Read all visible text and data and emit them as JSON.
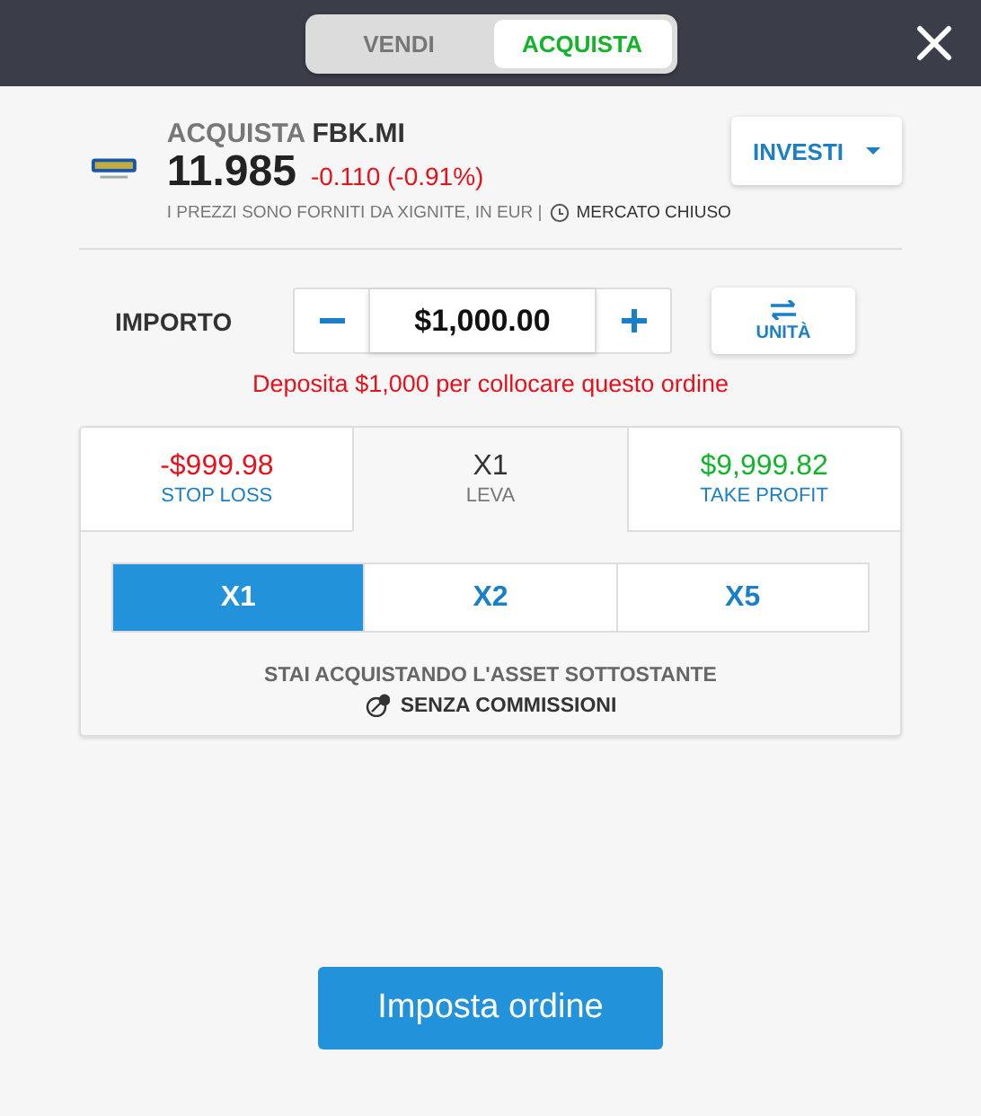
{
  "mode_tabs": [
    {
      "label": "VENDI",
      "selected": false
    },
    {
      "label": "ACQUISTA",
      "selected": true
    }
  ],
  "instrument": {
    "action": "ACQUISTA",
    "symbol": "FBK.MI",
    "price": "11.985",
    "change": "-0.110 (-0.91%)",
    "source_note": "I PREZZI SONO FORNITI DA XIGNITE, IN EUR |",
    "market_status": "MERCATO CHIUSO"
  },
  "invest_button": "INVESTI",
  "amount": {
    "label": "IMPORTO",
    "value": "$1,000.00"
  },
  "unit_button": "UNITÀ",
  "warning": "Deposita $1,000 per collocare questo ordine",
  "summary_tabs": [
    {
      "value": "-$999.98",
      "label": "STOP LOSS",
      "selected": false,
      "color": "#e8101a"
    },
    {
      "value": "X1",
      "label": "LEVA",
      "selected": true,
      "color": "#333333"
    },
    {
      "value": "$9,999.82",
      "label": "TAKE PROFIT",
      "selected": false,
      "color": "#10b52c"
    }
  ],
  "leverage_options": [
    {
      "label": "X1",
      "selected": true
    },
    {
      "label": "X2",
      "selected": false
    },
    {
      "label": "X5",
      "selected": false
    }
  ],
  "notice": "STAI ACQUISTANDO L'ASSET SOTTOSTANTE",
  "commission": "SENZA COMMISSIONI",
  "submit_button": "Imposta ordine"
}
